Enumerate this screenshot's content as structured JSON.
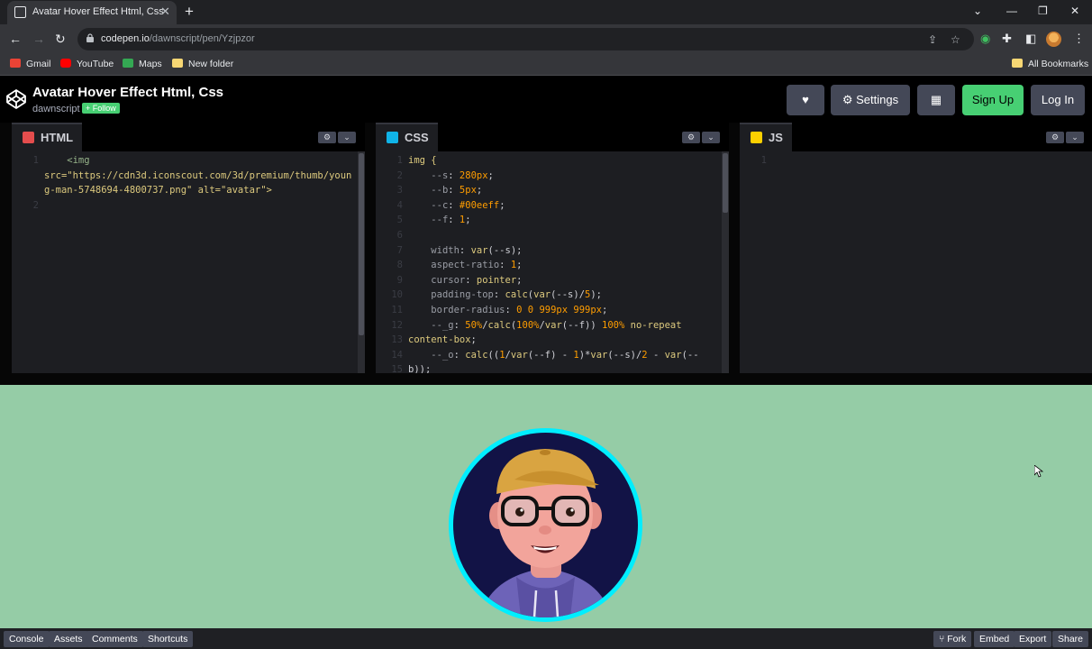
{
  "browser": {
    "tab_title": "Avatar Hover Effect Html, Css",
    "url_host": "codepen.io",
    "url_path": "/dawnscript/pen/Yzjpzor",
    "bookmarks": [
      "Gmail",
      "YouTube",
      "Maps",
      "New folder"
    ],
    "all_bookmarks": "All Bookmarks"
  },
  "header": {
    "title": "Avatar Hover Effect Html, Css",
    "author": "dawnscript",
    "follow": "+ Follow",
    "settings": "Settings",
    "signup": "Sign Up",
    "login": "Log In"
  },
  "editors": {
    "html": {
      "label": "HTML",
      "lines": [
        "    <img",
        "src=\"https://cdn3d.iconscout.com/3d/premium/thumb/youn",
        "g-man-5748694-4800737.png\" alt=\"avatar\">",
        ""
      ]
    },
    "css": {
      "label": "CSS",
      "lines": [
        "img {",
        "    --s: 280px;",
        "    --b: 5px;",
        "    --c: #00eeff;",
        "    --f: 1;",
        "",
        "    width: var(--s);",
        "    aspect-ratio: 1;",
        "    cursor: pointer;",
        "    padding-top: calc(var(--s)/5);",
        "    border-radius: 0 0 999px 999px;",
        "    --_g: 50%/calc(100%/var(--f)) 100% no-repeat",
        "content-box;",
        "    --_o: calc((1/var(--f) - 1)*var(--s)/2 - var(--",
        "b));"
      ]
    },
    "js": {
      "label": "JS"
    }
  },
  "preview": {
    "background": "#95cca6",
    "ring_color": "#00eeff"
  },
  "footer": {
    "left": [
      "Console",
      "Assets",
      "Comments",
      "Shortcuts"
    ],
    "right": [
      "Fork",
      "Embed",
      "Export",
      "Share"
    ]
  }
}
